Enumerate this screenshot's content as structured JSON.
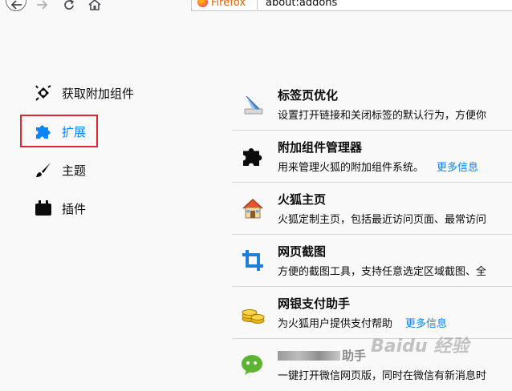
{
  "browser": {
    "identity_label": "Firefox",
    "url": "about:addons"
  },
  "sidebar": {
    "items": [
      {
        "label": "获取附加组件",
        "icon": "sparkle-puzzle-icon"
      },
      {
        "label": "扩展",
        "icon": "puzzle-icon",
        "selected": true
      },
      {
        "label": "主题",
        "icon": "brush-icon"
      },
      {
        "label": "插件",
        "icon": "plugin-icon"
      }
    ]
  },
  "addons": [
    {
      "name": "标签页优化",
      "description": "设置打开链接和关闭标签的默认行为，方便你",
      "more": "",
      "icon": "quill-icon"
    },
    {
      "name": "附加组件管理器",
      "description": "用来管理火狐的附加组件系统。",
      "more": "更多信息",
      "icon": "puzzle-icon"
    },
    {
      "name": "火狐主页",
      "description": "火狐定制主页，包括最近访问页面、最常访问",
      "more": "",
      "icon": "house-icon"
    },
    {
      "name": "网页截图",
      "description": "方便的截图工具，支持任意选定区域截图、全",
      "more": "",
      "icon": "crop-icon"
    },
    {
      "name": "网银支付助手",
      "description": "为火狐用户提供支付帮助",
      "more": "更多信息",
      "icon": "coins-icon"
    },
    {
      "name": "助手",
      "description": "一键打开微信网页版，同时在微信有新消息时",
      "more": "",
      "icon": "wechat-icon"
    }
  ],
  "watermark": "Baidu 经验",
  "colors": {
    "accent": "#0a84ff",
    "highlight": "#e0282e",
    "background": "#f9f9fa"
  }
}
